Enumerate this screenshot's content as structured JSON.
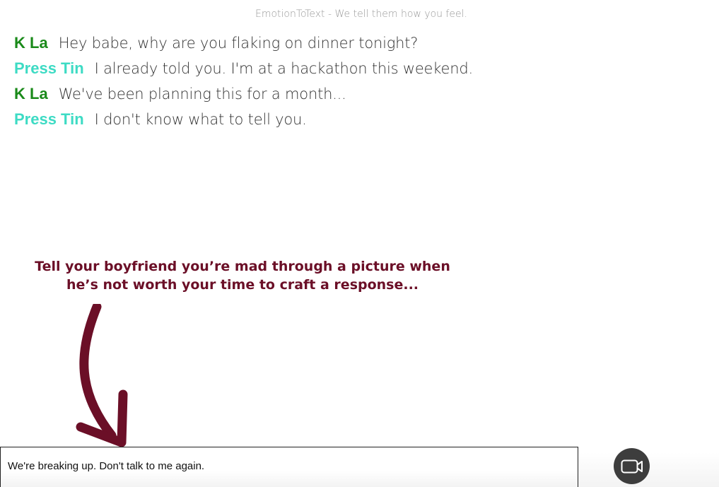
{
  "app": {
    "title": "EmotionToText - We tell them how you feel."
  },
  "colors": {
    "sender_a": "#1a8a1a",
    "sender_b": "#3ddbc4",
    "callout": "#6b0f27",
    "camera_button_bg": "#3d3d3d"
  },
  "messages": [
    {
      "sender": "K La",
      "text": "Hey babe, why are you flaking on dinner tonight?"
    },
    {
      "sender": "Press Tin",
      "text": "I already told you. I'm at a hackathon this weekend."
    },
    {
      "sender": "K La",
      "text": "We've been planning this for a month..."
    },
    {
      "sender": "Press Tin",
      "text": "I don't know what to tell you."
    }
  ],
  "callout": {
    "text": "Tell your boyfriend you’re mad through a picture when\nhe’s not worth your time to craft a response..."
  },
  "composer": {
    "value": "We're breaking up. Don't talk to me again."
  },
  "icons": {
    "arrow": "curved-arrow-down-icon",
    "camera": "video-camera-icon"
  }
}
